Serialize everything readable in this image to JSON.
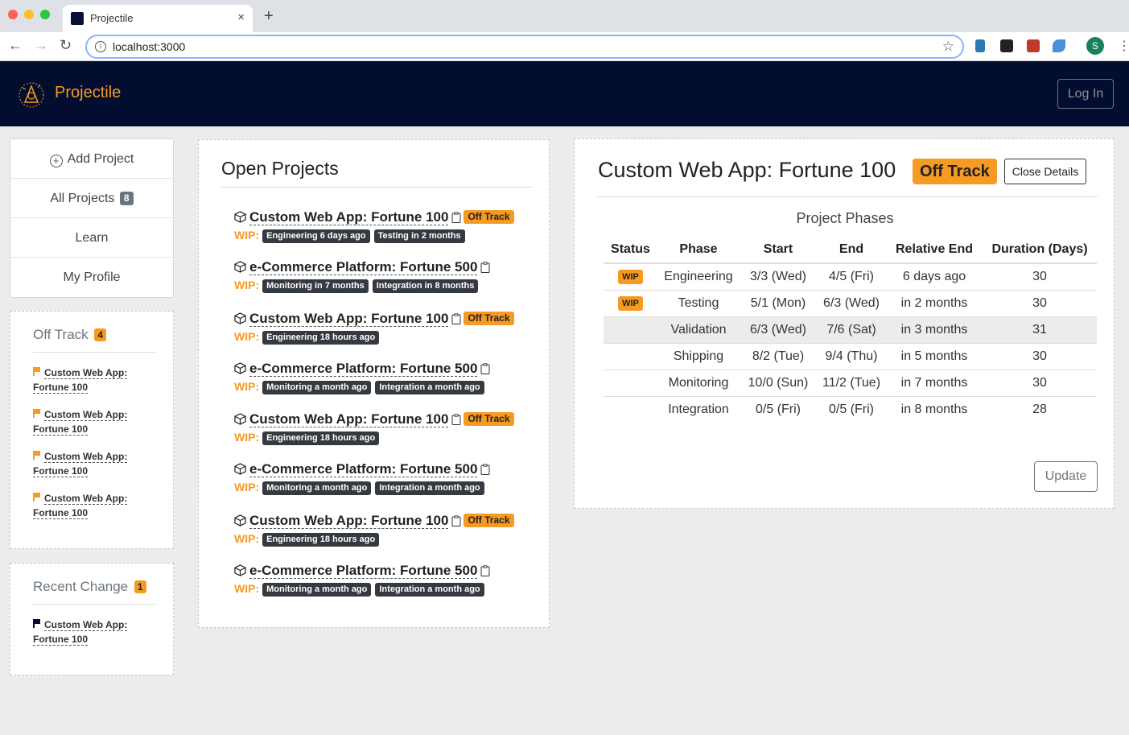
{
  "browser": {
    "tab_title": "Projectile",
    "tab_close": "×",
    "new_tab": "+",
    "url": "localhost:3000",
    "profile_initial": "S"
  },
  "header": {
    "brand": "Projectile",
    "login_label": "Log In"
  },
  "sidebar": {
    "add_project": "Add Project",
    "all_projects": "All Projects",
    "all_projects_count": "8",
    "learn": "Learn",
    "my_profile": "My Profile"
  },
  "off_track": {
    "title": "Off Track",
    "count": "4",
    "items": [
      {
        "name": "Custom Web App: Fortune 100"
      },
      {
        "name": "Custom Web App: Fortune 100"
      },
      {
        "name": "Custom Web App: Fortune 100"
      },
      {
        "name": "Custom Web App: Fortune 100"
      }
    ]
  },
  "recent_change": {
    "title": "Recent Change",
    "count": "1",
    "items": [
      {
        "name": "Custom Web App: Fortune 100"
      }
    ]
  },
  "open_projects": {
    "title": "Open Projects",
    "wip_label": "WIP:",
    "off_track_label": "Off Track",
    "items": [
      {
        "name": "Custom Web App: Fortune 100",
        "off_track": true,
        "phases": [
          "Engineering 6 days ago",
          "Testing in 2 months"
        ]
      },
      {
        "name": "e-Commerce Platform: Fortune 500",
        "off_track": false,
        "phases": [
          "Monitoring in 7 months",
          "Integration in 8 months"
        ]
      },
      {
        "name": "Custom Web App: Fortune 100",
        "off_track": true,
        "phases": [
          "Engineering 18 hours ago"
        ]
      },
      {
        "name": "e-Commerce Platform: Fortune 500",
        "off_track": false,
        "phases": [
          "Monitoring a month ago",
          "Integration a month ago"
        ]
      },
      {
        "name": "Custom Web App: Fortune 100",
        "off_track": true,
        "phases": [
          "Engineering 18 hours ago"
        ]
      },
      {
        "name": "e-Commerce Platform: Fortune 500",
        "off_track": false,
        "phases": [
          "Monitoring a month ago",
          "Integration a month ago"
        ]
      },
      {
        "name": "Custom Web App: Fortune 100",
        "off_track": true,
        "phases": [
          "Engineering 18 hours ago"
        ]
      },
      {
        "name": "e-Commerce Platform: Fortune 500",
        "off_track": false,
        "phases": [
          "Monitoring a month ago",
          "Integration a month ago"
        ]
      }
    ]
  },
  "details": {
    "title": "Custom Web App: Fortune 100",
    "status": "Off Track",
    "close_label": "Close Details",
    "phases_title": "Project Phases",
    "columns": [
      "Status",
      "Phase",
      "Start",
      "End",
      "Relative End",
      "Duration (Days)"
    ],
    "rows": [
      {
        "status": "WIP",
        "phase": "Engineering",
        "start": "3/3 (Wed)",
        "end": "4/5 (Fri)",
        "relative_end": "6 days ago",
        "duration": "30"
      },
      {
        "status": "WIP",
        "phase": "Testing",
        "start": "5/1 (Mon)",
        "end": "6/3 (Wed)",
        "relative_end": "in 2 months",
        "duration": "30"
      },
      {
        "status": "",
        "phase": "Validation",
        "start": "6/3 (Wed)",
        "end": "7/6 (Sat)",
        "relative_end": "in 3 months",
        "duration": "31"
      },
      {
        "status": "",
        "phase": "Shipping",
        "start": "8/2 (Tue)",
        "end": "9/4 (Thu)",
        "relative_end": "in 5 months",
        "duration": "30"
      },
      {
        "status": "",
        "phase": "Monitoring",
        "start": "10/0 (Sun)",
        "end": "11/2 (Tue)",
        "relative_end": "in 7 months",
        "duration": "30"
      },
      {
        "status": "",
        "phase": "Integration",
        "start": "0/5 (Fri)",
        "end": "0/5 (Fri)",
        "relative_end": "in 8 months",
        "duration": "28"
      }
    ],
    "update_label": "Update"
  },
  "colors": {
    "accent": "#f59a22",
    "header_bg": "#020d30",
    "dark_pill": "#343a40"
  },
  "icons": [
    "cube-icon",
    "clipboard-icon",
    "flag-icon",
    "plus-circle-icon",
    "star-icon"
  ]
}
